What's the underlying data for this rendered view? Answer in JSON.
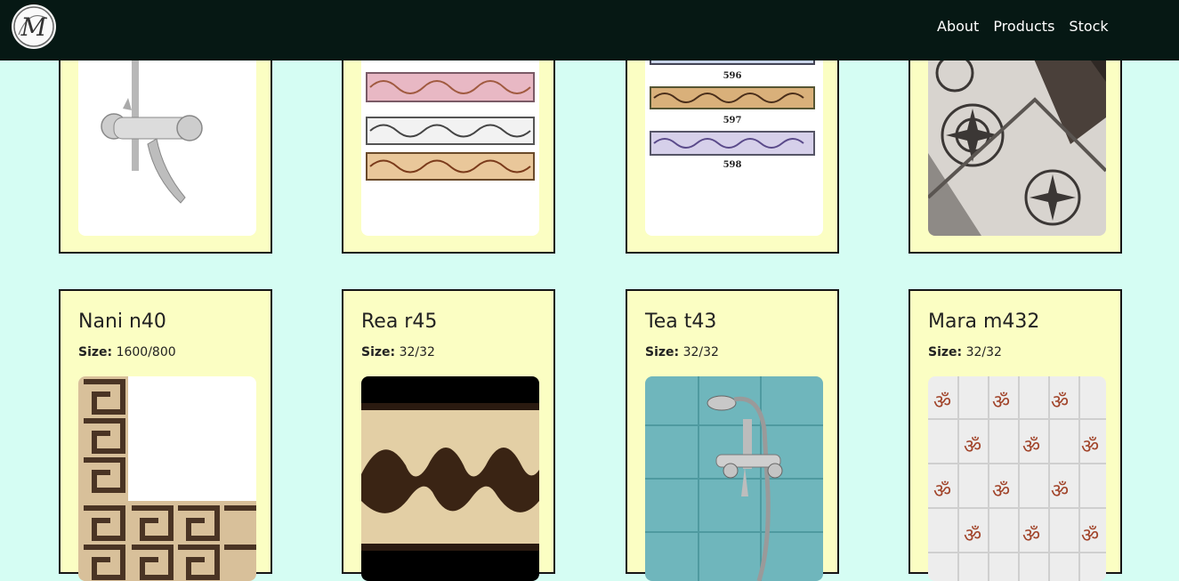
{
  "nav": {
    "logo_letter": "M",
    "links": [
      "About",
      "Products",
      "Stock"
    ]
  },
  "top_row_labels": [
    "596",
    "597",
    "598"
  ],
  "products": [
    {
      "name": "Nani n40",
      "size_label": "Size:",
      "size": "1600/800"
    },
    {
      "name": "Rea r45",
      "size_label": "Size:",
      "size": "32/32"
    },
    {
      "name": "Tea t43",
      "size_label": "Size:",
      "size": "32/32"
    },
    {
      "name": "Mara m432",
      "size_label": "Size:",
      "size": "32/32"
    }
  ],
  "om_glyph": "ॐ"
}
